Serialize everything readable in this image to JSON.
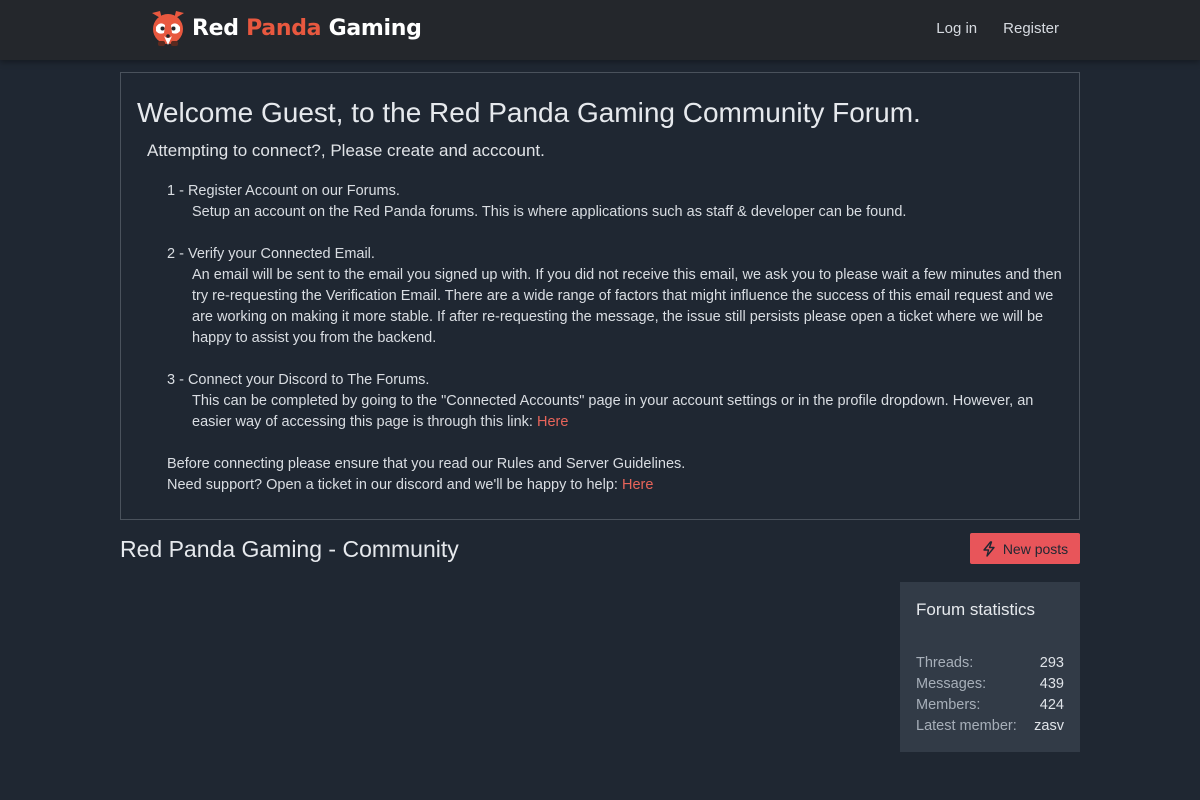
{
  "header": {
    "logo_words": [
      "Red",
      "Panda",
      "Gaming"
    ],
    "login_label": "Log in",
    "register_label": "Register"
  },
  "notice": {
    "title": "Welcome Guest, to the Red Panda Gaming Community Forum.",
    "subtitle": "Attempting to connect?, Please create and acccount.",
    "steps": [
      {
        "title": "1 - Register Account on our Forums.",
        "body": "Setup an account on the Red Panda forums. This is where applications such as staff & developer can be found."
      },
      {
        "title": "2 - Verify your Connected Email.",
        "body": "An email will be sent to the email you signed up with. If you did not receive this email, we ask you to please wait a few minutes and then try re-requesting the Verification Email. There are a wide range of factors that might influence the success of this email request and we are working on making it more stable. If after re-requesting the message, the issue still persists please open a ticket where we will be happy to assist you from the backend."
      },
      {
        "title": "3 - Connect your Discord to The Forums.",
        "body": "This can be completed by going to the \"Connected Accounts\" page in your account settings or in the profile dropdown. However, an easier way of accessing this page is through this link: ",
        "link_label": "Here"
      }
    ],
    "footer_line1": "Before connecting please ensure that you read our Rules and Server Guidelines.",
    "footer_line2": "Need support? Open a ticket in our discord and we'll be happy to help: ",
    "footer_link_label": "Here"
  },
  "main": {
    "section_title": "Red Panda Gaming - Community",
    "new_posts_label": "New posts",
    "new_posts_icon": "bolt-icon"
  },
  "stats": {
    "title": "Forum statistics",
    "rows": [
      {
        "label": "Threads:",
        "value": "293"
      },
      {
        "label": "Messages:",
        "value": "439"
      },
      {
        "label": "Members:",
        "value": "424"
      },
      {
        "label": "Latest member:",
        "value": "zasv"
      }
    ]
  },
  "colors": {
    "background": "#1f2732",
    "header": "#24272c",
    "accent": "#e8555a",
    "link": "#e8645a",
    "panel": "#323b47"
  }
}
